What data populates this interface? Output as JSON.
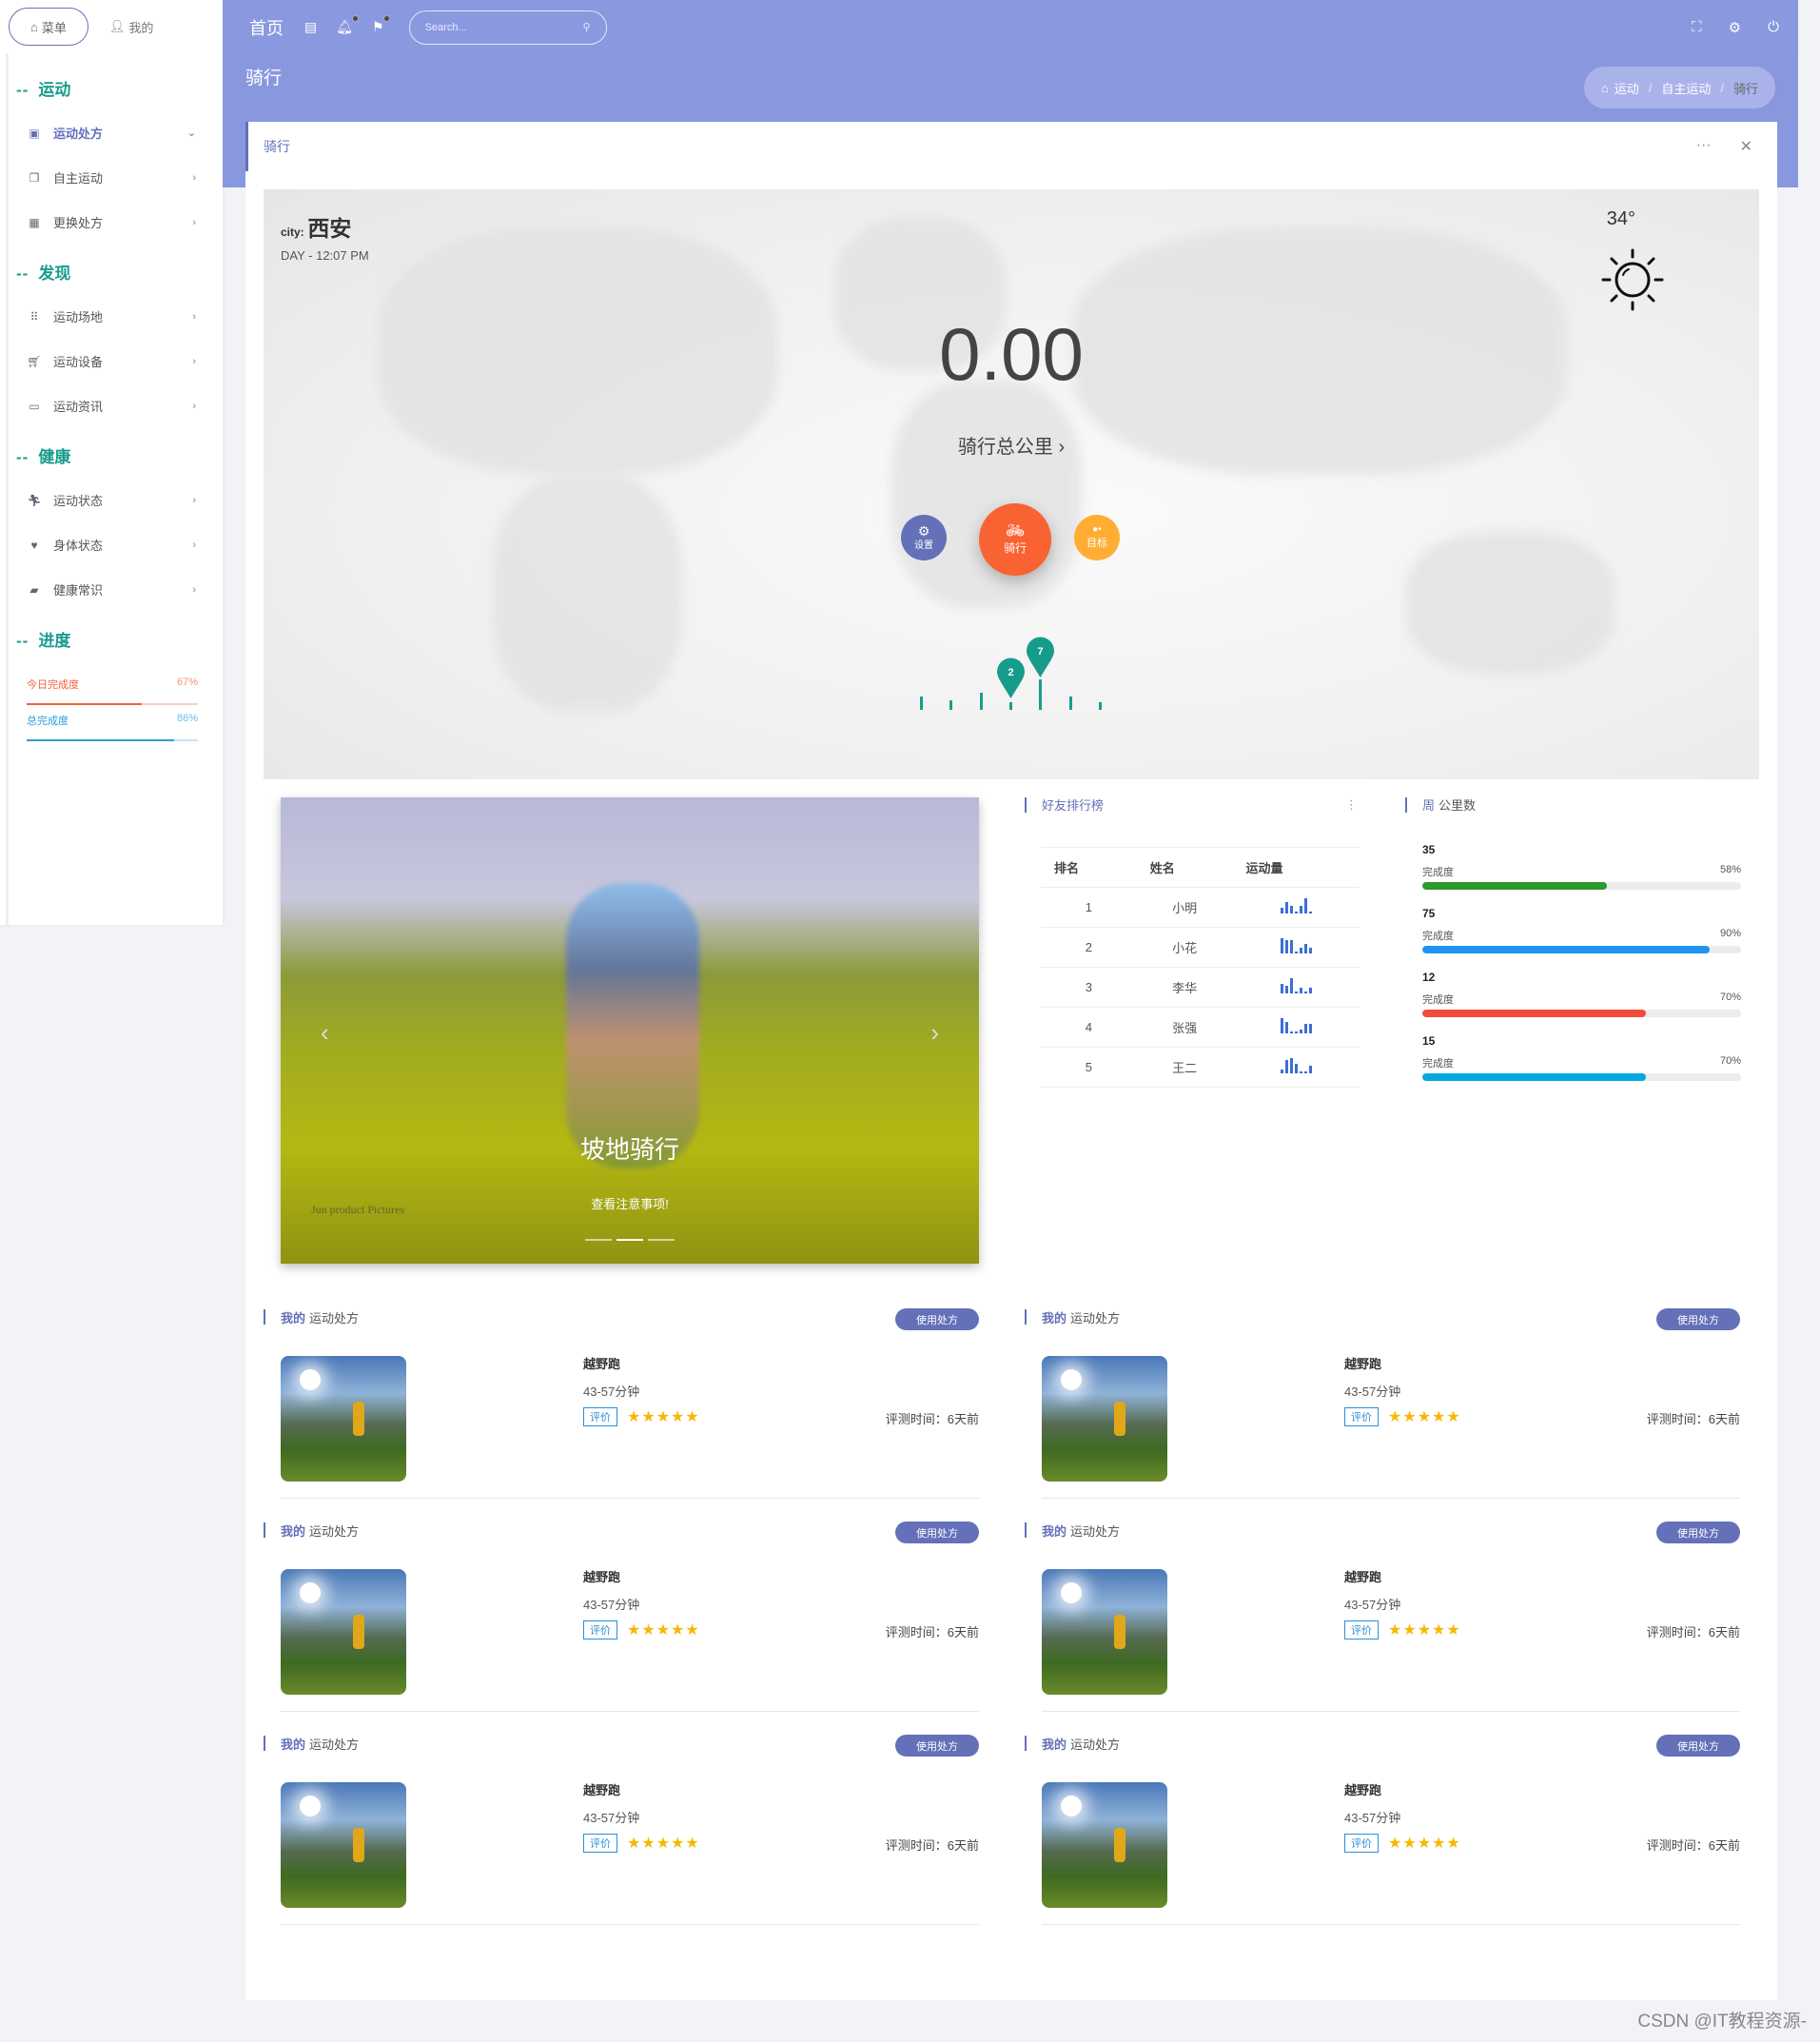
{
  "sidebar": {
    "tabs": [
      {
        "label": "菜单",
        "icon": "home-icon"
      },
      {
        "label": "我的",
        "icon": "user-icon"
      }
    ],
    "sections": [
      {
        "title": "运动",
        "items": [
          {
            "label": "运动处方",
            "icon": "clipboard-icon",
            "active": true,
            "chevron": "⌄"
          },
          {
            "label": "自主运动",
            "icon": "copy-icon",
            "chevron": "›"
          },
          {
            "label": "更换处方",
            "icon": "calendar-icon",
            "chevron": "›"
          }
        ]
      },
      {
        "title": "发现",
        "items": [
          {
            "label": "运动场地",
            "icon": "grid-icon",
            "chevron": "›"
          },
          {
            "label": "运动设备",
            "icon": "cart-icon",
            "chevron": "›"
          },
          {
            "label": "运动资讯",
            "icon": "monitor-icon",
            "chevron": "›"
          }
        ]
      },
      {
        "title": "健康",
        "items": [
          {
            "label": "运动状态",
            "icon": "running-icon",
            "chevron": "›"
          },
          {
            "label": "身体状态",
            "icon": "heart-icon",
            "chevron": "›"
          },
          {
            "label": "健康常识",
            "icon": "book-reader-icon",
            "chevron": "›"
          }
        ]
      },
      {
        "title": "进度",
        "items": []
      }
    ],
    "progress": [
      {
        "label": "今日完成度",
        "value": "67%",
        "percent": 67,
        "color": "#f0643c",
        "track": "#f5d3c5"
      },
      {
        "label": "总完成度",
        "value": "86%",
        "percent": 86,
        "color": "#2b9fd9",
        "track": "#c9e4f5"
      }
    ]
  },
  "topbar": {
    "home": "首页",
    "search_placeholder": "Search...",
    "icons": [
      "sidebar-toggle-icon",
      "bell-icon",
      "flag-icon"
    ],
    "right_icons": [
      "fullscreen-icon",
      "gear-icon",
      "power-icon"
    ]
  },
  "page": {
    "title": "骑行",
    "breadcrumb": [
      "运动",
      "自主运动",
      "骑行"
    ]
  },
  "card": {
    "title": "骑行",
    "more": "···",
    "close": "✕"
  },
  "hero": {
    "city_label": "city:",
    "city": "西安",
    "time": "DAY - 12:07 PM",
    "temperature": "34°",
    "distance": "0.00",
    "distance_label": "骑行总公里",
    "buttons": [
      {
        "label": "设置",
        "icon": "gear-icon",
        "color": "#6470b8"
      },
      {
        "label": "骑行",
        "icon": "bicycle-icon",
        "color": "#f96332"
      },
      {
        "label": "目标",
        "icon": "bubbles-icon",
        "color": "#ffad33"
      }
    ],
    "pins": [
      "2",
      "7"
    ],
    "accent": "#179c8c"
  },
  "carousel": {
    "title": "坡地骑行",
    "subtitle": "查看注意事项!",
    "watermark": "Jun product Pictures",
    "slides": 3,
    "active_slide": 2
  },
  "ranking": {
    "title": "好友排行榜",
    "headers": [
      "排名",
      "姓名",
      "运动量"
    ],
    "rows": [
      {
        "rank": "1",
        "name": "小明",
        "spark": [
          3,
          6,
          4,
          1,
          4,
          8,
          1
        ]
      },
      {
        "rank": "2",
        "name": "小花",
        "spark": [
          8,
          7,
          7,
          1,
          3,
          5,
          3
        ]
      },
      {
        "rank": "3",
        "name": "李华",
        "spark": [
          5,
          4,
          8,
          1,
          3,
          1,
          3
        ]
      },
      {
        "rank": "4",
        "name": "张强",
        "spark": [
          8,
          6,
          1,
          1,
          2,
          5,
          5
        ]
      },
      {
        "rank": "5",
        "name": "王二",
        "spark": [
          2,
          7,
          8,
          5,
          1,
          1,
          4
        ]
      }
    ]
  },
  "weekly": {
    "title_hl": "周",
    "title": "公里数",
    "items": [
      {
        "value": "35",
        "label": "完成度",
        "percent_text": "58%",
        "percent": 58,
        "color": "#2c9a2c"
      },
      {
        "value": "75",
        "label": "完成度",
        "percent_text": "90%",
        "percent": 90,
        "color": "#2194f3"
      },
      {
        "value": "12",
        "label": "完成度",
        "percent_text": "70%",
        "percent": 70,
        "color": "#f44a3c"
      },
      {
        "value": "15",
        "label": "完成度",
        "percent_text": "70%",
        "percent": 70,
        "color": "#03a9e0"
      }
    ]
  },
  "prescriptions": [
    {
      "hl": "我的",
      "title": "运动处方",
      "button": "使用处方",
      "name": "越野跑",
      "duration": "43-57分钟",
      "tag": "评价",
      "stars": "★★★★★",
      "rating": 5,
      "time": "评测时间：6天前"
    },
    {
      "hl": "我的",
      "title": "运动处方",
      "button": "使用处方",
      "name": "越野跑",
      "duration": "43-57分钟",
      "tag": "评价",
      "stars": "★★★★★",
      "rating": 5,
      "time": "评测时间：6天前"
    },
    {
      "hl": "我的",
      "title": "运动处方",
      "button": "使用处方",
      "name": "越野跑",
      "duration": "43-57分钟",
      "tag": "评价",
      "stars": "★★★★★",
      "rating": 5,
      "time": "评测时间：6天前"
    },
    {
      "hl": "我的",
      "title": "运动处方",
      "button": "使用处方",
      "name": "越野跑",
      "duration": "43-57分钟",
      "tag": "评价",
      "stars": "★★★★★",
      "rating": 5,
      "time": "评测时间：6天前"
    },
    {
      "hl": "我的",
      "title": "运动处方",
      "button": "使用处方",
      "name": "越野跑",
      "duration": "43-57分钟",
      "tag": "评价",
      "stars": "★★★★★",
      "rating": 5,
      "time": "评测时间：6天前"
    },
    {
      "hl": "我的",
      "title": "运动处方",
      "button": "使用处方",
      "name": "越野跑",
      "duration": "43-57分钟",
      "tag": "评价",
      "stars": "★★★★★",
      "rating": 5,
      "time": "评测时间：6天前"
    }
  ],
  "watermark": "CSDN @IT教程资源-"
}
